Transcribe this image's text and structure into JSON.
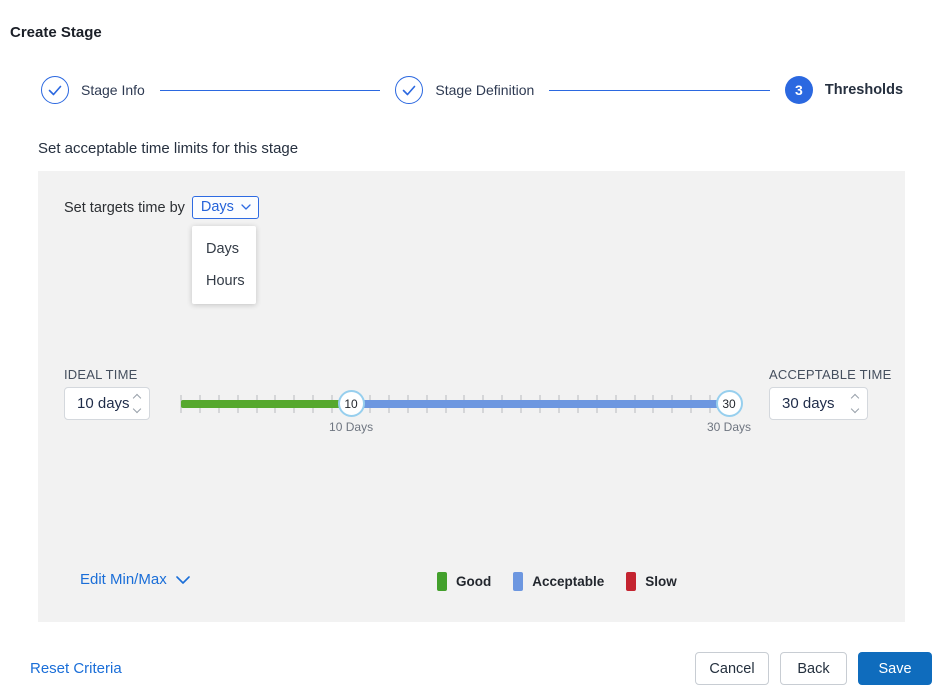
{
  "page": {
    "title": "Create Stage"
  },
  "stepper": {
    "steps": [
      {
        "label": "Stage Info",
        "state": "complete"
      },
      {
        "label": "Stage Definition",
        "state": "complete"
      },
      {
        "label": "Thresholds",
        "state": "current",
        "number": "3"
      }
    ]
  },
  "section": {
    "heading": "Set acceptable time limits for this stage"
  },
  "targets": {
    "label": "Set targets time by",
    "selected": "Days",
    "options": [
      "Days",
      "Hours"
    ]
  },
  "ideal_time": {
    "label": "IDEAL TIME",
    "value": "10 days"
  },
  "acceptable_time": {
    "label": "ACCEPTABLE TIME",
    "value": "30 days"
  },
  "slider": {
    "min": 1,
    "max": 30,
    "ideal_value": 10,
    "acceptable_value": 30,
    "ideal_handle_text": "10",
    "acceptable_handle_text": "30",
    "ideal_label": "10 Days",
    "acceptable_label": "30 Days",
    "good_color": "#56a82e",
    "acceptable_color": "#6d97e0"
  },
  "edit_minmax": {
    "label": "Edit Min/Max"
  },
  "legend": [
    {
      "label": "Good",
      "color": "#43a02c"
    },
    {
      "label": "Acceptable",
      "color": "#6d97e0"
    },
    {
      "label": "Slow",
      "color": "#c42430"
    }
  ],
  "footer": {
    "reset_label": "Reset Criteria",
    "cancel_label": "Cancel",
    "back_label": "Back",
    "save_label": "Save"
  },
  "colors": {
    "primary_blue": "#2b68e0",
    "link_blue": "#1a6ed8",
    "save_blue": "#0f6cbd",
    "panel_bg": "#f2f2f2",
    "handle_ring": "#97cfee"
  }
}
